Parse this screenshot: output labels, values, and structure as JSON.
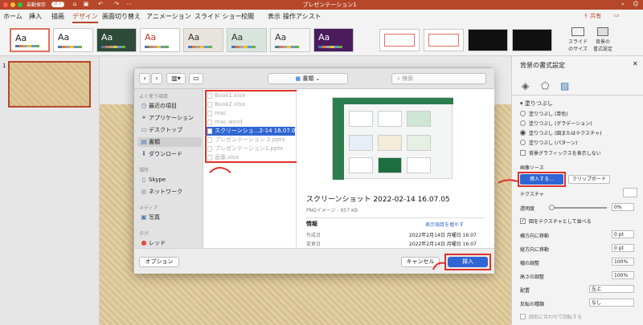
{
  "titlebar": {
    "autosave_label": "自動保存",
    "autosave_state": "オフ",
    "doc_title": "プレゼンテーション1",
    "bg_color": "#b7472a"
  },
  "ribbon_tabs": [
    "ホーム",
    "挿入",
    "描画",
    "デザイン",
    "画面切り替え",
    "アニメーション",
    "スライド ショー",
    "校閲",
    "表示",
    "操作アシスト"
  ],
  "active_tab": "デザイン",
  "share_label": "共有",
  "ribbon": {
    "themes": [
      {
        "aa": "Aa",
        "bg": "#ffffff",
        "fg": "#222222",
        "selected": true
      },
      {
        "aa": "Aa",
        "bg": "#ffffff",
        "fg": "#222222"
      },
      {
        "aa": "Aa",
        "bg": "#2e4a3a",
        "fg": "#ffffff"
      },
      {
        "aa": "Aa",
        "bg": "#ffffff",
        "fg": "#c0392b"
      },
      {
        "aa": "Aa",
        "bg": "#e8e4dc",
        "fg": "#333333"
      },
      {
        "aa": "Aa",
        "bg": "#d9e4dd",
        "fg": "#333333"
      },
      {
        "aa": "Aa",
        "bg": "#f4f4f4",
        "fg": "#333333"
      },
      {
        "aa": "Aa",
        "bg": "#4b1b5e",
        "fg": "#ffffff"
      }
    ],
    "slide_size_label": "スライド\nのサイズ",
    "bg_format_label": "背景の\n書式設定"
  },
  "thumbnail": {
    "number": "1"
  },
  "format_pane": {
    "title": "背景の書式設定",
    "section": "塗りつぶし",
    "fill_options": [
      {
        "label": "塗りつぶし (単色)",
        "on": false
      },
      {
        "label": "塗りつぶし (グラデーション)",
        "on": false
      },
      {
        "label": "塗りつぶし (図またはテクスチャ)",
        "on": true
      },
      {
        "label": "塗りつぶし (パターン)",
        "on": false
      }
    ],
    "hide_bg_graphics": "背景グラフィックスを表示しない",
    "image_source_label": "画像ソース",
    "insert_button": "挿入する...",
    "clipboard_button": "クリップボード",
    "texture_label": "テクスチャ",
    "transparency_label": "透明度",
    "transparency_value": "0%",
    "tile_label": "図をテクスチャとして並べる",
    "offset_x_label": "横方向に移動",
    "offset_x_value": "0 pt",
    "offset_y_label": "縦方向に移動",
    "offset_y_value": "0 pt",
    "scale_x_label": "幅の調整",
    "scale_x_value": "100%",
    "scale_y_label": "高さの調整",
    "scale_y_value": "100%",
    "align_label": "配置",
    "align_value": "左上",
    "mirror_label": "反転の種類",
    "mirror_value": "なし",
    "rotate_label": "図形に合わせて回転する"
  },
  "dialog": {
    "folder": "書類",
    "search_placeholder": "検索",
    "sidebar": {
      "favorites_header": "よく使う項目",
      "favorites": [
        {
          "label": "最近の項目",
          "icon": "clock-icon"
        },
        {
          "label": "アプリケーション",
          "icon": "apps-icon"
        },
        {
          "label": "デスクトップ",
          "icon": "desktop-icon"
        },
        {
          "label": "書類",
          "icon": "document-icon",
          "selected": true
        },
        {
          "label": "ダウンロード",
          "icon": "download-icon"
        }
      ],
      "locations_header": "場所",
      "locations": [
        {
          "label": "Skype",
          "icon": "disk-icon"
        },
        {
          "label": "ネットワーク",
          "icon": "network-icon"
        }
      ],
      "media_header": "メディア",
      "media": [
        {
          "label": "写真",
          "icon": "camera-icon"
        }
      ],
      "tags_header": "タグ",
      "tags": [
        {
          "label": "レッド",
          "color": "#e74c3c"
        },
        {
          "label": "オレンジ",
          "color": "#f39c12"
        }
      ]
    },
    "files": [
      {
        "name": "Book1.xlsx",
        "selected": false
      },
      {
        "name": "Book2.xlsx",
        "selected": false
      },
      {
        "name": "mac",
        "selected": false
      },
      {
        "name": "mac word",
        "selected": false
      },
      {
        "name": "スクリーンショ…2-14 16.07.05",
        "selected": true
      },
      {
        "name": "プレゼンテーション 2.pptx",
        "selected": false
      },
      {
        "name": "プレゼンテーション1.pptx",
        "selected": false
      },
      {
        "name": "画像.xlsx",
        "selected": false
      }
    ],
    "preview": {
      "name": "スクリーンショット 2022-02-14 16.07.05",
      "kind": "PNGイメージ - 957 KB",
      "info_header": "情報",
      "more_link": "表示項目を増やす",
      "rows": [
        {
          "label": "作成日",
          "value": "2022年2月14日 月曜日 16:07"
        },
        {
          "label": "変更日",
          "value": "2022年2月14日 月曜日 16:07"
        },
        {
          "label": "最後に開いた日",
          "value": "2022年2月14日 月曜日 16:07"
        }
      ]
    },
    "options_button": "オプション",
    "cancel_button": "キャンセル",
    "insert_button": "挿入"
  }
}
